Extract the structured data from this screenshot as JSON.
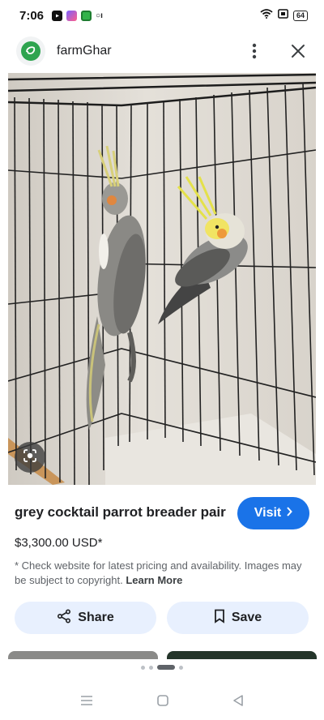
{
  "status_bar": {
    "time": "7:06",
    "battery": "64",
    "app_icons": [
      "youtube-icon",
      "app-icon-1",
      "app-icon-2",
      "sim-icon"
    ],
    "icons": [
      "wifi-icon",
      "volte-icon",
      "battery-icon"
    ]
  },
  "header": {
    "site_name": "farmGhar",
    "logo_icon": "farmghar-logo",
    "menu_icon": "more-vert-icon",
    "close_icon": "close-icon"
  },
  "product": {
    "title": "grey cocktail parrot breader pair",
    "price": "$3,300.00 USD*",
    "disclaimer": "* Check website for latest pricing and availability. Images may be subject to copyright.",
    "learn_more": "Learn More",
    "image_subject": "two-cockatiels-in-cage"
  },
  "actions": {
    "visit_label": "Visit",
    "share_label": "Share",
    "save_label": "Save"
  },
  "pagination": {
    "total": 4,
    "active": 3
  },
  "nav": {
    "icons": [
      "recent-apps-icon",
      "home-icon",
      "back-icon"
    ]
  },
  "colors": {
    "accent": "#1a73e8",
    "action_bg": "#e8f0fe",
    "brand_green": "#2ea44f"
  }
}
